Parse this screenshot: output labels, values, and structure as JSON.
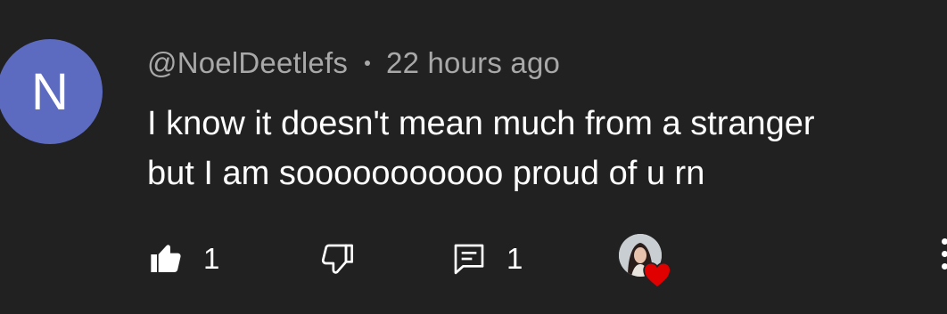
{
  "comment": {
    "avatar_letter": "N",
    "avatar_color": "#5c6bc0",
    "author": "@NoelDeetlefs",
    "timestamp": "22 hours ago",
    "text_lines": [
      "I know it doesn't mean much from a stranger",
      "but I am sooooooooooo proud of u rn"
    ]
  },
  "actions": {
    "like_icon": "thumb-up-filled-icon",
    "like_count": "1",
    "dislike_icon": "thumb-down-icon",
    "reply_icon": "comment-icon",
    "reply_count": "1",
    "creator_heart_icon": "heart-icon",
    "heart_color": "#e00000",
    "more_icon": "more-vertical-icon"
  }
}
